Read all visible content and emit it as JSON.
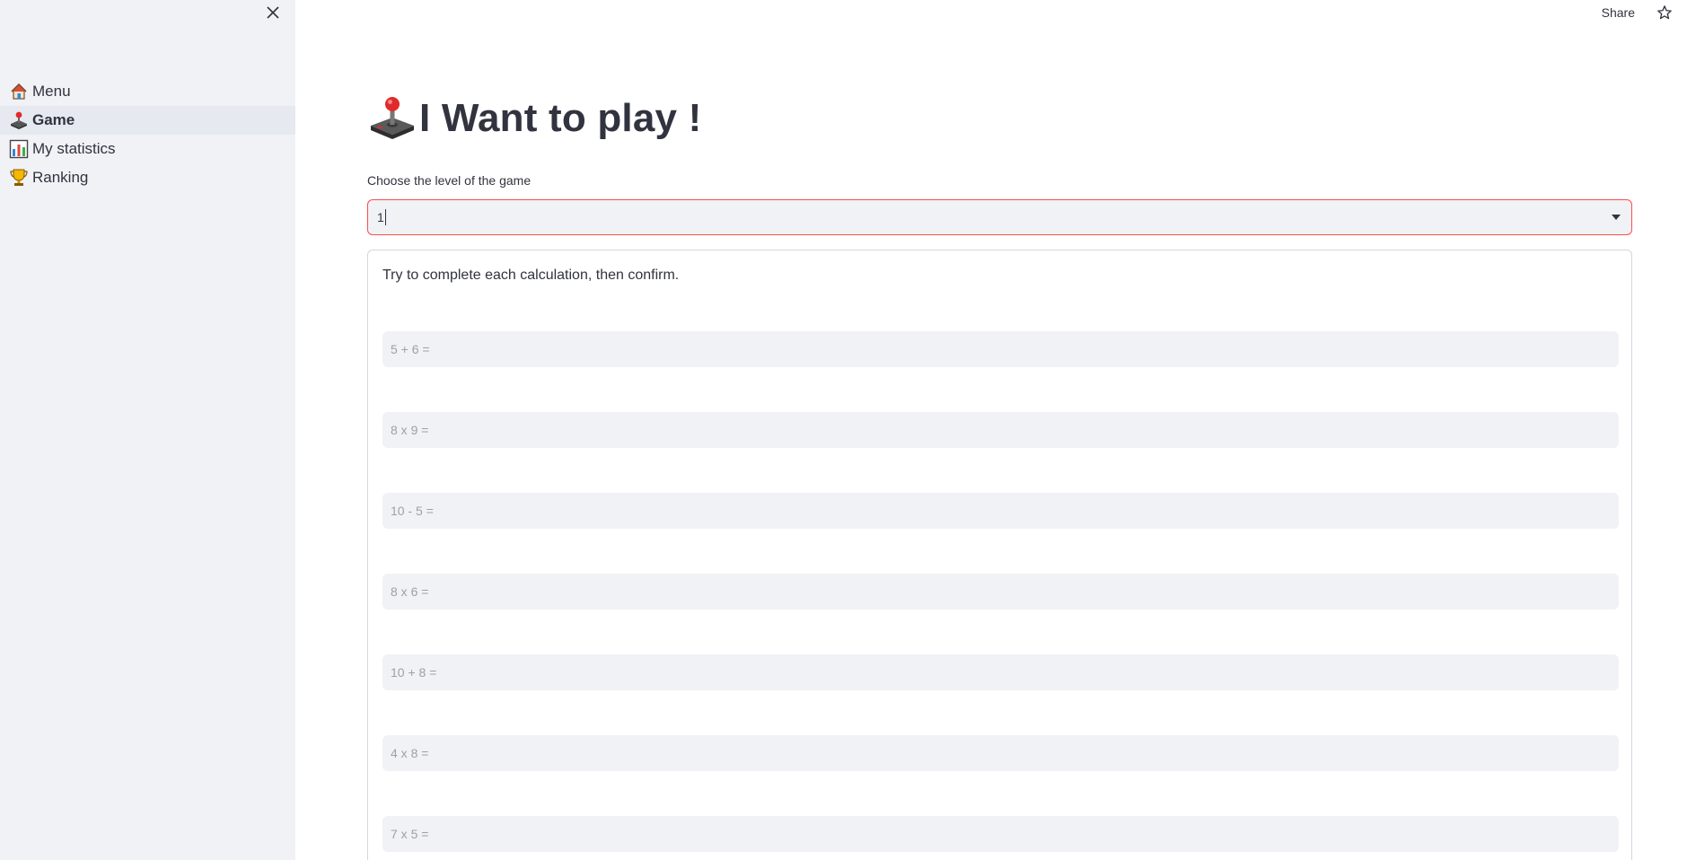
{
  "sidebar": {
    "items": [
      {
        "label": "Menu",
        "icon": "house-icon",
        "active": false
      },
      {
        "label": "Game",
        "icon": "joystick-icon",
        "active": true
      },
      {
        "label": "My statistics",
        "icon": "bar-chart-icon",
        "active": false
      },
      {
        "label": "Ranking",
        "icon": "trophy-icon",
        "active": false
      }
    ]
  },
  "header": {
    "share_label": "Share"
  },
  "main": {
    "title": "I Want to play !",
    "level_label": "Choose the level of the game",
    "level_value": "1",
    "instructions": "Try to complete each calculation, then confirm.",
    "calculations": [
      {
        "placeholder": "5 + 6 ="
      },
      {
        "placeholder": "8 x 9 ="
      },
      {
        "placeholder": "10 - 5 ="
      },
      {
        "placeholder": "8 x 6 ="
      },
      {
        "placeholder": "10 + 8 ="
      },
      {
        "placeholder": "4 x 8 ="
      },
      {
        "placeholder": "7 x 5 ="
      }
    ]
  },
  "colors": {
    "accent": "#ff4b4b",
    "sidebar_bg": "#f0f2f6",
    "text": "#31333f"
  }
}
